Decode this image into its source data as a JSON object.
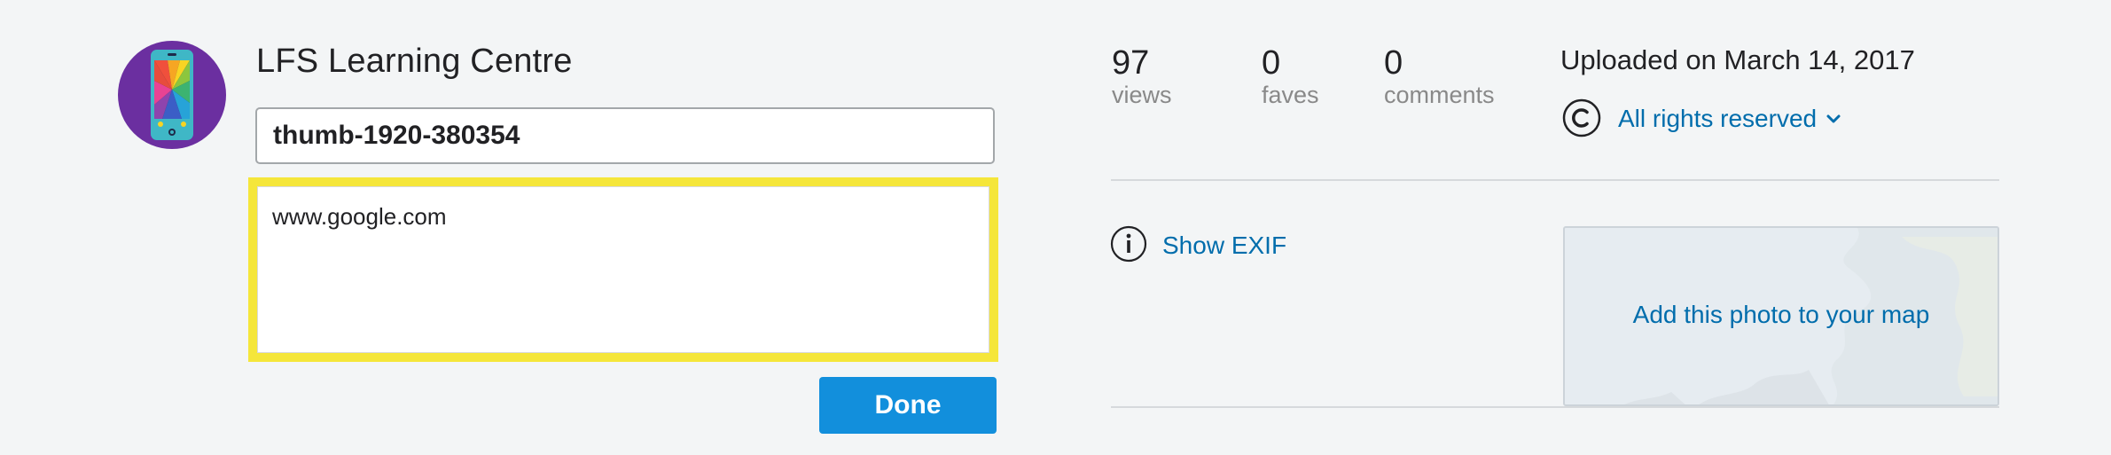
{
  "owner": {
    "name": "LFS Learning Centre"
  },
  "edit_form": {
    "title_value": "thumb-1920-380354",
    "description_value": "www.google.com",
    "done_label": "Done"
  },
  "stats": [
    {
      "value": "97",
      "label": "views"
    },
    {
      "value": "0",
      "label": "faves"
    },
    {
      "value": "0",
      "label": "comments"
    }
  ],
  "upload": {
    "text": "Uploaded on March 14, 2017"
  },
  "license": {
    "label": "All rights reserved",
    "icon": "copyright-icon"
  },
  "exif": {
    "label": "Show EXIF",
    "icon": "info-icon"
  },
  "map": {
    "label": "Add this photo to your map"
  },
  "colors": {
    "highlight": "#f5e63a",
    "link": "#006dac",
    "button": "#128fdc",
    "avatar_bg": "#6b2fa0"
  }
}
